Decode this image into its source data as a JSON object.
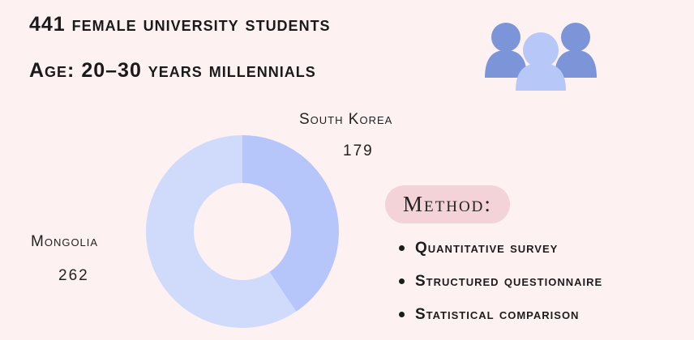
{
  "header": {
    "line1": "441 female university students",
    "line2": "Age: 20–30 years millennials"
  },
  "icons": {
    "people": "people-group-icon"
  },
  "colors": {
    "background": "#fdf1f1",
    "south_korea_slice": "#b6c6fa",
    "mongolia_slice": "#d0dbfb",
    "people_back": "#7b95d8",
    "people_front": "#b7c7f8",
    "method_badge": "#f3d3d7"
  },
  "chart_data": {
    "type": "pie",
    "donut": true,
    "slices": [
      {
        "label": "South Korea",
        "value": 179
      },
      {
        "label": "Mongolia",
        "value": 262
      }
    ]
  },
  "method": {
    "title": "Method:",
    "items": [
      "Quantitative survey",
      "Structured questionnaire",
      "Statistical comparison"
    ]
  }
}
